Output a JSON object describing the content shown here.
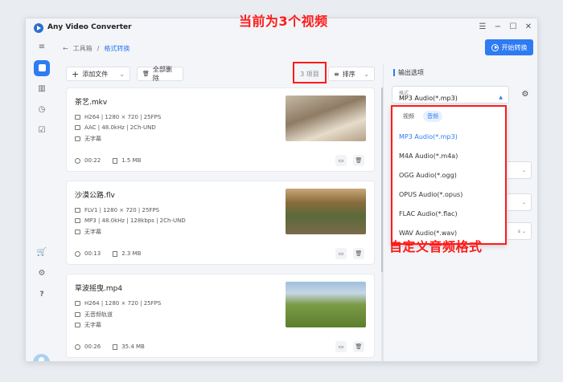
{
  "app": {
    "title": "Any Video Converter"
  },
  "window_controls": {
    "menu": "☰",
    "minimize": "−",
    "maximize": "☐",
    "close": "✕"
  },
  "breadcrumb": {
    "back": "←",
    "root": "工具箱",
    "sep": "/",
    "current": "格式转换"
  },
  "header": {
    "start_label": "开始转换"
  },
  "annotations": {
    "top": "当前为3个视频",
    "bottom": "自定义音频格式"
  },
  "toolbar": {
    "add_label": "添加文件",
    "delete_all_label": "全部删除",
    "items_count": "3 项目",
    "sort_label": "排序"
  },
  "files": [
    {
      "name": "茶艺.mkv",
      "video": "H264 | 1280 × 720 | 25FPS",
      "audio": "AAC | 48.0kHz | 2Ch-UND",
      "subtitle": "无字幕",
      "duration": "00:22",
      "size": "1.5 MB"
    },
    {
      "name": "沙漠公路.flv",
      "video": "FLV1 | 1280 × 720 | 25FPS",
      "audio": "MP3 | 48.0kHz | 128kbps | 2Ch-UND",
      "subtitle": "无字幕",
      "duration": "00:13",
      "size": "2.3 MB"
    },
    {
      "name": "草波摇曳.mp4",
      "video": "H264 | 1280 × 720 | 25FPS",
      "audio": "无音频轨道",
      "subtitle": "无字幕",
      "duration": "00:26",
      "size": "35.4 MB"
    }
  ],
  "panel": {
    "title": "输出选项",
    "format_label": "格式",
    "format_value": "MP3 Audio(*.mp3)",
    "ghost_value": "s"
  },
  "dropdown": {
    "tabs": [
      "视频",
      "音频"
    ],
    "active_tab": 1,
    "options": [
      "MP3 Audio(*.mp3)",
      "M4A Audio(*.m4a)",
      "OGG Audio(*.ogg)",
      "OPUS Audio(*.opus)",
      "FLAC Audio(*.flac)",
      "WAV Audio(*.wav)"
    ],
    "selected": 0
  },
  "colors": {
    "accent": "#2e7bf3",
    "annotation": "#ff1a1a"
  },
  "icons": {
    "add": "+",
    "trash": "🗑",
    "folder": "📁",
    "sort": "≡",
    "caret": "⌄",
    "gear": "⚙",
    "back": "←"
  }
}
